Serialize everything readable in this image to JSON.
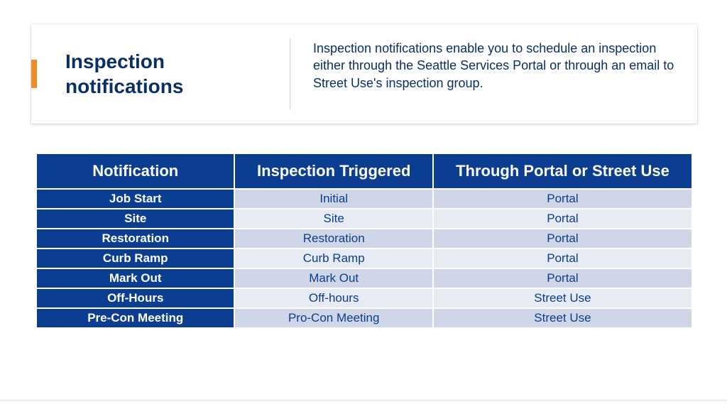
{
  "header": {
    "title": "Inspection notifications",
    "description": "Inspection notifications enable you to schedule an inspection either through the Seattle Services Portal or through an email to Street Use's inspection group."
  },
  "table": {
    "columns": [
      "Notification",
      "Inspection Triggered",
      "Through Portal or Street Use"
    ],
    "rows": [
      {
        "notification": "Job Start",
        "triggered": "Initial",
        "via": "Portal"
      },
      {
        "notification": "Site",
        "triggered": "Site",
        "via": "Portal"
      },
      {
        "notification": "Restoration",
        "triggered": "Restoration",
        "via": "Portal"
      },
      {
        "notification": "Curb Ramp",
        "triggered": "Curb Ramp",
        "via": "Portal"
      },
      {
        "notification": "Mark Out",
        "triggered": "Mark Out",
        "via": "Portal"
      },
      {
        "notification": "Off-Hours",
        "triggered": "Off-hours",
        "via": "Street Use"
      },
      {
        "notification": "Pre-Con Meeting",
        "triggered": "Pro-Con Meeting",
        "via": "Street Use"
      }
    ]
  }
}
